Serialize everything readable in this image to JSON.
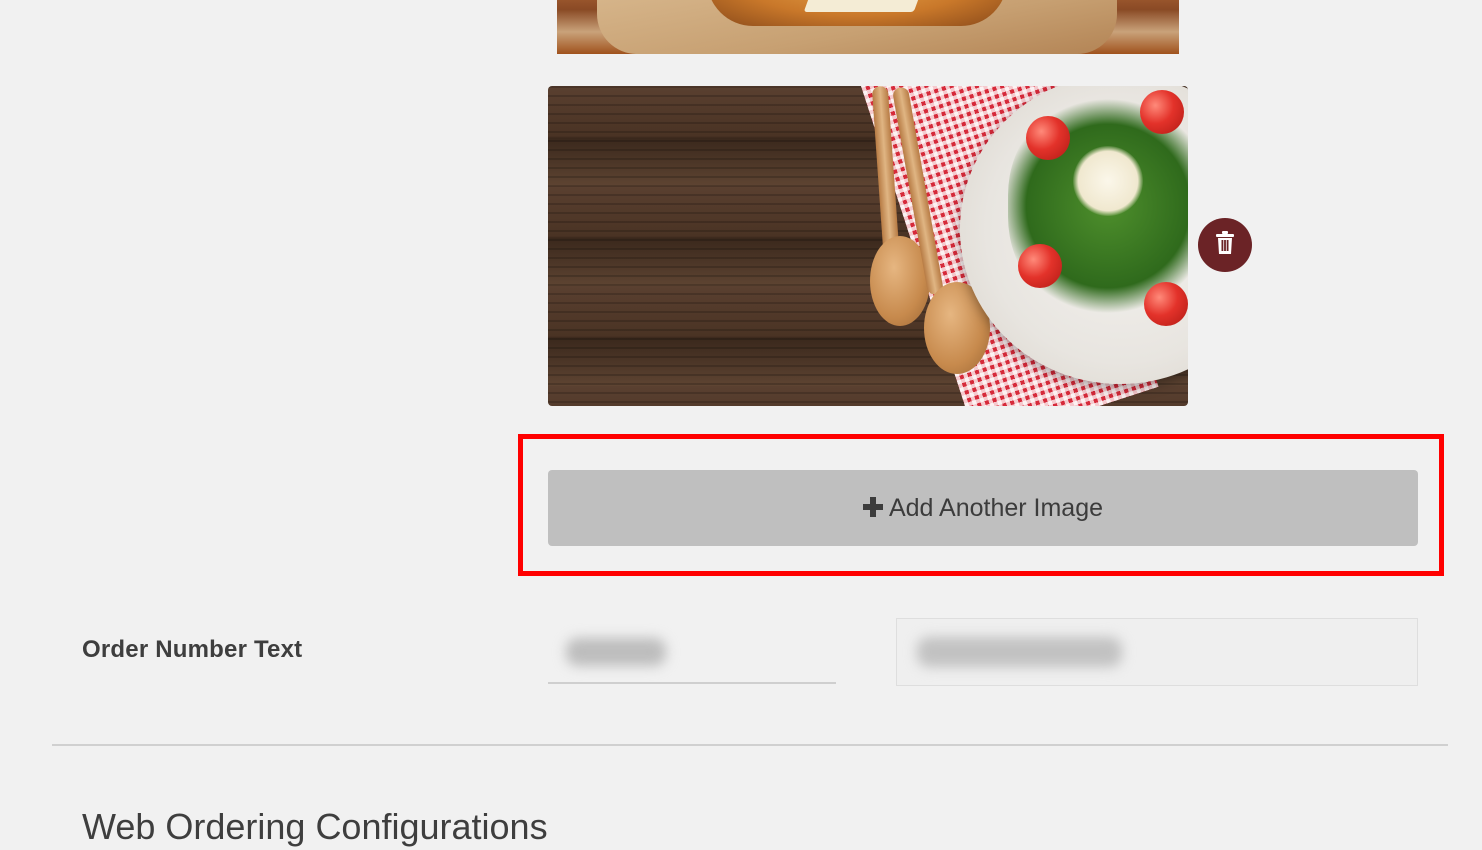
{
  "images": {
    "top_image": {
      "subject": "burger on paper"
    },
    "salad_image": {
      "subject": "salad plate with wooden spoons on checkered cloth"
    },
    "delete_icon": "trash-icon",
    "delete_color": "#6b2326"
  },
  "add_image_button": {
    "icon": "plus-icon",
    "label": "Add Another Image"
  },
  "highlight_color": "#ff0000",
  "order_number": {
    "label": "Order Number Text"
  },
  "section": {
    "title": "Web Ordering Configurations"
  }
}
